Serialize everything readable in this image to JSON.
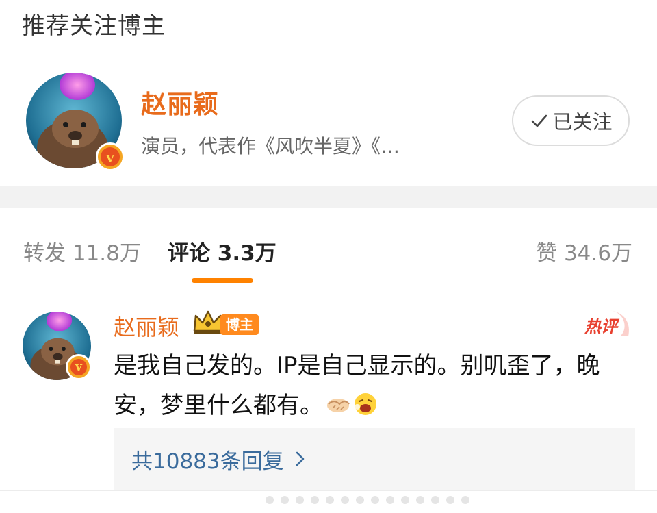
{
  "section": {
    "title": "推荐关注博主"
  },
  "recommend": {
    "name": "赵丽颖",
    "desc": "演员，代表作《风吹半夏》《…",
    "follow_label": "已关注",
    "badge": "v"
  },
  "tabs": {
    "repost": "转发 11.8万",
    "comment": "评论 3.3万",
    "like": "赞 34.6万",
    "active": "comment"
  },
  "comment": {
    "author": "赵丽颖",
    "role_tag": "博主",
    "hot_label": "热评",
    "text": "是我自己发的。IP是自己显示的。别叽歪了，晚安，梦里什么都有。",
    "emojis": [
      "handshake-emoji",
      "laughing-emoji"
    ],
    "replies_label": "共10883条回复"
  },
  "colors": {
    "accent_orange": "#ff8200",
    "name_orange": "#e86b1c",
    "link_blue": "#3a6b9c"
  }
}
